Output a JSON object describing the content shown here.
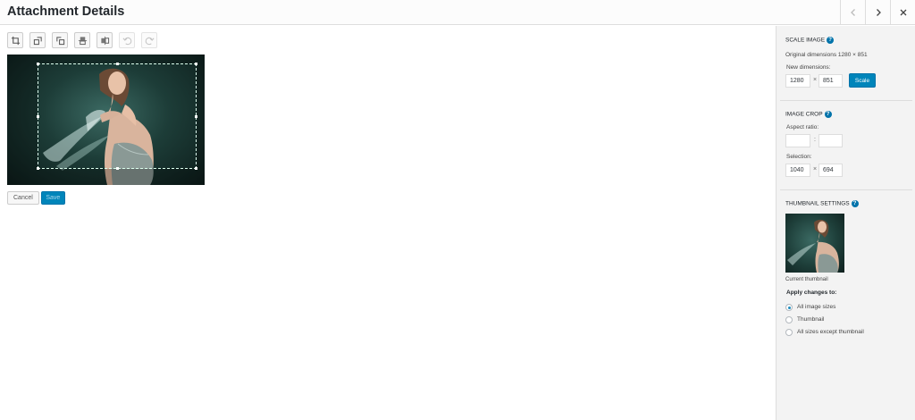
{
  "header": {
    "title": "Attachment Details"
  },
  "toolbar": {
    "buttons": [
      "crop-icon",
      "rotate-left-icon",
      "rotate-right-icon",
      "flip-vertical-icon",
      "flip-horizontal-icon",
      "undo-icon",
      "redo-icon"
    ]
  },
  "editor": {
    "cancel_label": "Cancel",
    "save_label": "Save"
  },
  "scale": {
    "title": "Scale Image",
    "original_label": "Original dimensions 1280 × 851",
    "new_label": "New dimensions:",
    "width": "1280",
    "height": "851",
    "times": "×",
    "button": "Scale"
  },
  "crop": {
    "title": "Image Crop",
    "aspect_label": "Aspect ratio:",
    "aspect_w": "",
    "aspect_h": "",
    "colon": ":",
    "selection_label": "Selection:",
    "sel_w": "1040",
    "sel_h": "694",
    "times": "×"
  },
  "thumbnail": {
    "title": "Thumbnail Settings",
    "caption": "Current thumbnail",
    "apply_label": "Apply changes to:",
    "options": [
      "All image sizes",
      "Thumbnail",
      "All sizes except thumbnail"
    ],
    "selected": "All image sizes"
  },
  "help_glyph": "?",
  "colors": {
    "accent": "#0085ba",
    "sidebar_bg": "#f3f3f3"
  }
}
